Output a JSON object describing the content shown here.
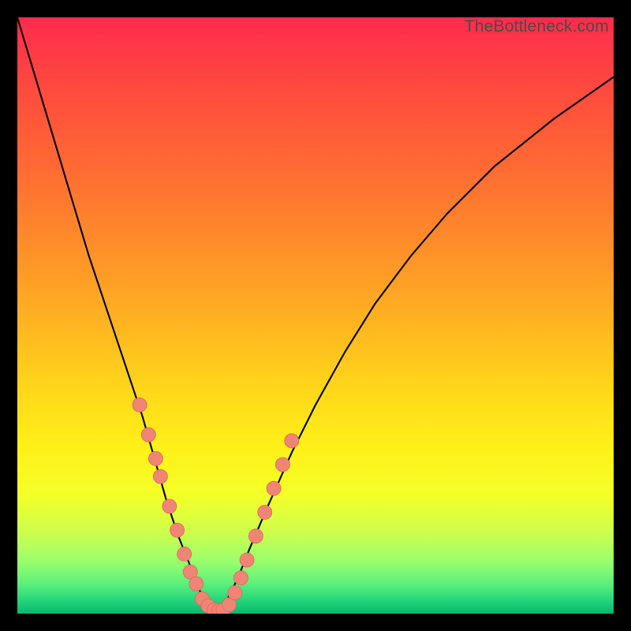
{
  "watermark": "TheBottleneck.com",
  "chart_data": {
    "type": "line",
    "title": "",
    "xlabel": "",
    "ylabel": "",
    "xlim": [
      0,
      100
    ],
    "ylim": [
      0,
      100
    ],
    "curve": {
      "name": "bottleneck-curve",
      "x": [
        0,
        3,
        6,
        9,
        12,
        15,
        18,
        21,
        23,
        25,
        27,
        29,
        30.5,
        32,
        33.2,
        34,
        35,
        37,
        39,
        42,
        46,
        50,
        55,
        60,
        66,
        72,
        80,
        90,
        100
      ],
      "y": [
        100,
        90,
        80,
        70,
        60,
        51,
        42,
        33,
        26,
        19,
        13,
        8,
        4,
        1.5,
        0.5,
        0.6,
        2,
        6,
        11,
        18,
        27,
        35,
        44,
        52,
        60,
        67,
        75,
        83,
        90
      ]
    },
    "markers": {
      "name": "sample-points",
      "color": "#f08576",
      "points": [
        {
          "x": 20.5,
          "y": 35
        },
        {
          "x": 22.0,
          "y": 30
        },
        {
          "x": 23.2,
          "y": 26
        },
        {
          "x": 24.0,
          "y": 23
        },
        {
          "x": 25.5,
          "y": 18
        },
        {
          "x": 26.8,
          "y": 14
        },
        {
          "x": 28.0,
          "y": 10
        },
        {
          "x": 29.0,
          "y": 7
        },
        {
          "x": 30.0,
          "y": 5
        },
        {
          "x": 31.0,
          "y": 2.5
        },
        {
          "x": 32.0,
          "y": 1.3
        },
        {
          "x": 33.0,
          "y": 0.6
        },
        {
          "x": 33.8,
          "y": 0.5
        },
        {
          "x": 34.5,
          "y": 0.6
        },
        {
          "x": 35.5,
          "y": 1.5
        },
        {
          "x": 36.5,
          "y": 3.5
        },
        {
          "x": 37.5,
          "y": 6
        },
        {
          "x": 38.5,
          "y": 9
        },
        {
          "x": 40.0,
          "y": 13
        },
        {
          "x": 41.5,
          "y": 17
        },
        {
          "x": 43.0,
          "y": 21
        },
        {
          "x": 44.5,
          "y": 25
        },
        {
          "x": 46.0,
          "y": 29
        }
      ]
    },
    "gradient_stops": [
      {
        "pos": 0,
        "color": "#ff2a4d"
      },
      {
        "pos": 50,
        "color": "#ffd61a"
      },
      {
        "pos": 100,
        "color": "#0bb56e"
      }
    ]
  }
}
